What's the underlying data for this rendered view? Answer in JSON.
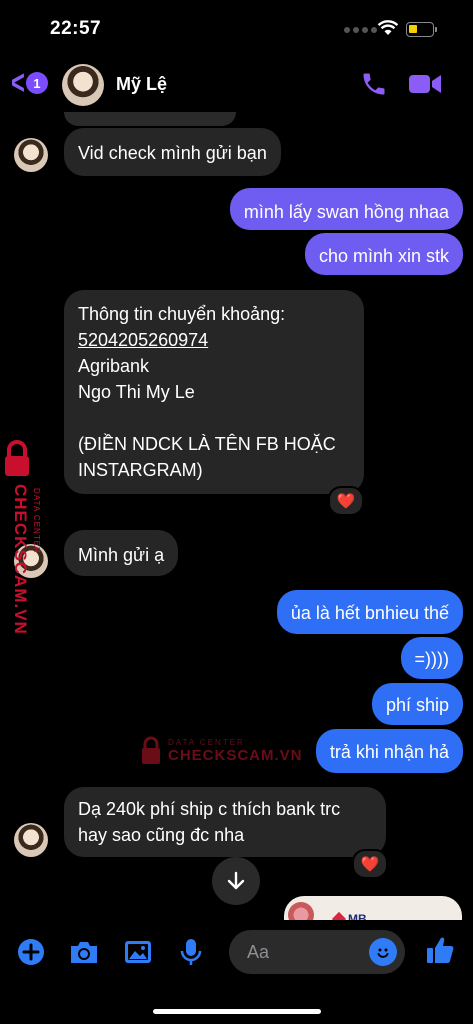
{
  "status": {
    "time": "22:57"
  },
  "header": {
    "back_badge": "1",
    "contact_name": "Mỹ Lệ"
  },
  "messages": [
    {
      "text": "Vid check mình gửi bạn"
    },
    {
      "text": "mình lấy swan hồng nhaa"
    },
    {
      "text": "cho mình xin stk"
    },
    {
      "line1": "Thông tin chuyển khoảng:",
      "account": "5204205260974",
      "bank": "Agribank",
      "name": "Ngo Thi My Le",
      "note": "(ĐIỀN NDCK LÀ TÊN FB HOẶC INSTARGRAM)",
      "reaction": "❤️"
    },
    {
      "text": "Mình gửi ạ"
    },
    {
      "text": "ủa là hết bnhieu thế"
    },
    {
      "text": "=))))"
    },
    {
      "text": "phí ship"
    },
    {
      "text": "trả khi nhận hả"
    },
    {
      "text": "Dạ 240k phí ship c thích bank trc hay sao cũng đc nha",
      "reaction": "❤️"
    }
  ],
  "watermark": {
    "brand": "CHECKSCAM.VN",
    "sub": "DATA CENTER"
  },
  "preview": {
    "label": "MB"
  },
  "composer": {
    "placeholder": "Aa"
  },
  "icons": [
    "back-chevron-icon",
    "phone-icon",
    "video-camera-icon",
    "plus-icon",
    "camera-icon",
    "image-icon",
    "microphone-icon",
    "emoji-icon",
    "thumbs-up-icon",
    "arrow-down-icon"
  ],
  "colors": {
    "outgoing_purple": "#6f5cf0",
    "outgoing_blue": "#2f6ff5",
    "accent": "#8b5cf6",
    "incoming": "#262626"
  }
}
